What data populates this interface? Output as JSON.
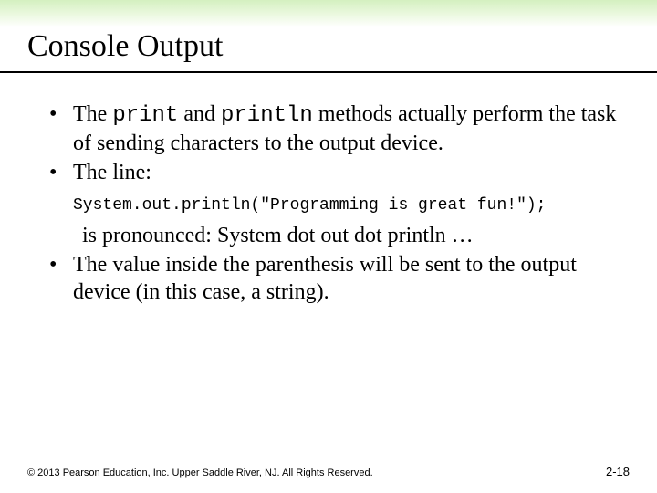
{
  "title": "Console Output",
  "bullets": {
    "b1": {
      "pre": "The ",
      "code1": "print",
      "mid": " and ",
      "code2": "println",
      "post": " methods actually perform the task of sending characters to the output device."
    },
    "b2": "The line:",
    "code_line": "System.out.println(\"Programming is great fun!\");",
    "cont": "is pronounced: System dot out dot println …",
    "b3": "The value inside the parenthesis will be sent to the output device (in this case, a string)."
  },
  "footer": {
    "left": "© 2013 Pearson Education, Inc. Upper Saddle River, NJ. All Rights Reserved.",
    "right": "2-18"
  },
  "bullet_char": "•"
}
